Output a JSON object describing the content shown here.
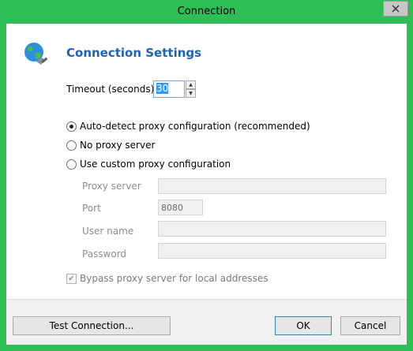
{
  "window": {
    "title": "Connection"
  },
  "heading": "Connection Settings",
  "timeout": {
    "label": "Timeout (seconds)",
    "value": "30"
  },
  "proxy_options": [
    {
      "label": "Auto-detect proxy configuration (recommended)",
      "checked": true
    },
    {
      "label": "No proxy server",
      "checked": false
    },
    {
      "label": "Use custom proxy configuration",
      "checked": false
    }
  ],
  "fields": {
    "proxy_server": {
      "label": "Proxy server",
      "value": ""
    },
    "port": {
      "label": "Port",
      "value": "8080"
    },
    "user_name": {
      "label": "User name",
      "value": ""
    },
    "password": {
      "label": "Password",
      "value": ""
    }
  },
  "bypass": {
    "label": "Bypass proxy server for local addresses",
    "checked": true
  },
  "buttons": {
    "test": "Test Connection...",
    "ok": "OK",
    "cancel": "Cancel"
  },
  "icons": {
    "close": "close-icon",
    "globe": "globe-icon"
  },
  "colors": {
    "window_frame": "#2fbd56",
    "heading": "#1d63b3"
  }
}
